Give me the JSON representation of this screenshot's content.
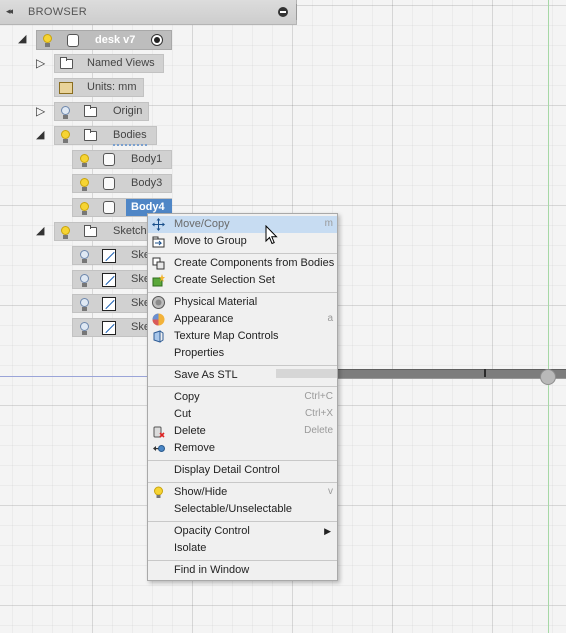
{
  "browser": {
    "title": "BROWSER",
    "collapse_glyph": "◂◂",
    "minimize_icon": "minus-circle-icon"
  },
  "tree": {
    "root": {
      "label": "desk v7"
    },
    "named_views": {
      "label": "Named Views"
    },
    "units": {
      "label": "Units: mm"
    },
    "origin": {
      "label": "Origin"
    },
    "bodies": {
      "label": "Bodies"
    },
    "body_items": [
      {
        "label": "Body1"
      },
      {
        "label": "Body3"
      },
      {
        "label": "Body4"
      }
    ],
    "sketches": {
      "label": "Sketche"
    },
    "sketch_items": [
      {
        "label": "Ske"
      },
      {
        "label": "Ske"
      },
      {
        "label": "Ske"
      },
      {
        "label": "Ske"
      }
    ]
  },
  "context_menu": {
    "items": {
      "move_copy": {
        "label": "Move/Copy",
        "shortcut": "m"
      },
      "move_to_group": {
        "label": "Move to Group"
      },
      "create_components": {
        "label": "Create Components from Bodies"
      },
      "create_selection_set": {
        "label": "Create Selection Set"
      },
      "physical_material": {
        "label": "Physical Material"
      },
      "appearance": {
        "label": "Appearance",
        "shortcut": "a"
      },
      "texture_map": {
        "label": "Texture Map Controls"
      },
      "properties": {
        "label": "Properties"
      },
      "save_as_stl": {
        "label": "Save As STL"
      },
      "copy": {
        "label": "Copy",
        "shortcut": "Ctrl+C"
      },
      "cut": {
        "label": "Cut",
        "shortcut": "Ctrl+X"
      },
      "delete": {
        "label": "Delete",
        "shortcut": "Delete"
      },
      "remove": {
        "label": "Remove"
      },
      "display_detail": {
        "label": "Display Detail Control"
      },
      "show_hide": {
        "label": "Show/Hide",
        "shortcut": "v"
      },
      "selectable": {
        "label": "Selectable/Unselectable"
      },
      "opacity": {
        "label": "Opacity Control"
      },
      "isolate": {
        "label": "Isolate"
      },
      "find_in_window": {
        "label": "Find in Window"
      }
    }
  },
  "colors": {
    "selection_blue": "#4f86c6",
    "menu_highlight": "#c7dcf2",
    "bulb_on": "#f6d433"
  }
}
